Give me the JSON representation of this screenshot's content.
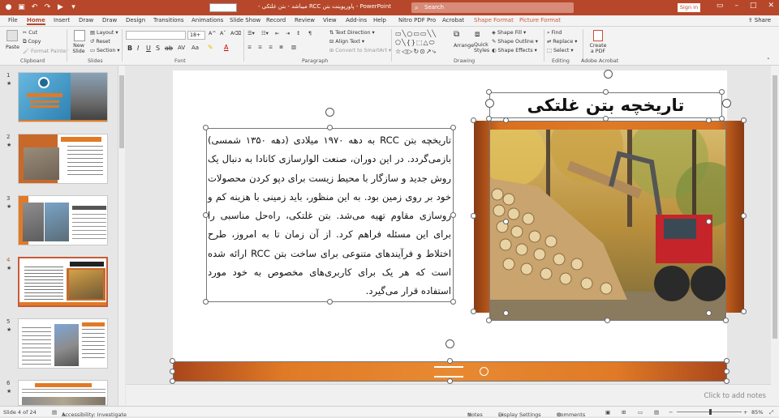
{
  "window": {
    "doc_title": "پاورپوینت بتن RCC میباشد - بتن غلتکی -",
    "app_name": "PowerPoint",
    "search_placeholder": "Search",
    "signin_label": "Sign in",
    "share_label": "Share"
  },
  "tabs": [
    {
      "label": "File"
    },
    {
      "label": "Home"
    },
    {
      "label": "Insert"
    },
    {
      "label": "Draw"
    },
    {
      "label": "Draw"
    },
    {
      "label": "Design"
    },
    {
      "label": "Transitions"
    },
    {
      "label": "Animations"
    },
    {
      "label": "Slide Show"
    },
    {
      "label": "Record"
    },
    {
      "label": "Review"
    },
    {
      "label": "View"
    },
    {
      "label": "Add-ins"
    },
    {
      "label": "Help"
    },
    {
      "label": "Nitro PDF Pro"
    },
    {
      "label": "Acrobat"
    },
    {
      "label": "Shape Format"
    },
    {
      "label": "Picture Format"
    }
  ],
  "ribbon": {
    "clipboard": {
      "paste": "Paste",
      "cut": "Cut",
      "copy": "Copy",
      "format_painter": "Format Painter",
      "label": "Clipboard"
    },
    "slides": {
      "new_slide": "New Slide",
      "layout": "Layout",
      "reset": "Reset",
      "section": "Section",
      "label": "Slides"
    },
    "font": {
      "size": "18+",
      "label": "Font"
    },
    "paragraph": {
      "text_direction": "Text Direction",
      "align_text": "Align Text",
      "smartart": "Convert to SmartArt",
      "label": "Paragraph"
    },
    "drawing": {
      "arrange": "Arrange",
      "quick_styles": "Quick Styles",
      "shape_fill": "Shape Fill",
      "shape_outline": "Shape Outline",
      "shape_effects": "Shape Effects",
      "label": "Drawing"
    },
    "editing": {
      "find": "Find",
      "replace": "Replace",
      "select": "Select",
      "label": "Editing"
    },
    "acrobat": {
      "create_pdf": "Create a PDF",
      "label": "Adobe Acrobat"
    }
  },
  "thumbnails": [
    {
      "num": "1",
      "title": "معرفی بتن غلتکی",
      "active": false
    },
    {
      "num": "2",
      "title": "تعریف بتن غلتکی",
      "active": false
    },
    {
      "num": "3",
      "title": "بتن RCC چیست؟",
      "active": false
    },
    {
      "num": "4",
      "title": "تاریخچه بتن غلتکی",
      "active": true
    },
    {
      "num": "5",
      "title": "مزیت‌های بتن غلتکی",
      "active": false
    },
    {
      "num": "6",
      "title": "نمونه‌هایی از بتن غلتکی",
      "active": false
    }
  ],
  "slide": {
    "title": "تاریخچه بتن غلتکی",
    "body": "تاریخچه بتن RCC به دهه ۱۹۷۰ میلادی (دهه ۱۳۵۰ شمسی) بازمی‌گردد. در این دوران، صنعت الوارسازی کانادا به دنبال یک روش جدید و سازگار با محیط زیست برای دپو کردن محصولات خود بر روی زمین بود. به این منظور، باید زمینی با هزینه کم و روسازی مقاوم تهیه می‌شد. بتن غلتکی، راه‌حل مناسبی را برای این مسئله فراهم کرد. از آن زمان تا به امروز، طرح اختلاط و فرآیندهای متنوعی برای ساخت بتن RCC ارائه شده است که هر یک برای کاربری‌های مخصوص به خود مورد استفاده قرار می‌گیرد."
  },
  "notes_placeholder": "Click to add notes",
  "status": {
    "slide_of": "Slide 4 of 24",
    "accessibility": "Accessibility: Investigate",
    "notes": "Notes",
    "display_settings": "Display Settings",
    "comments": "Comments",
    "zoom": "85%"
  },
  "colors": {
    "accent": "#b7472a",
    "orange": "#e07a26",
    "dark_orange": "#a9461b"
  }
}
